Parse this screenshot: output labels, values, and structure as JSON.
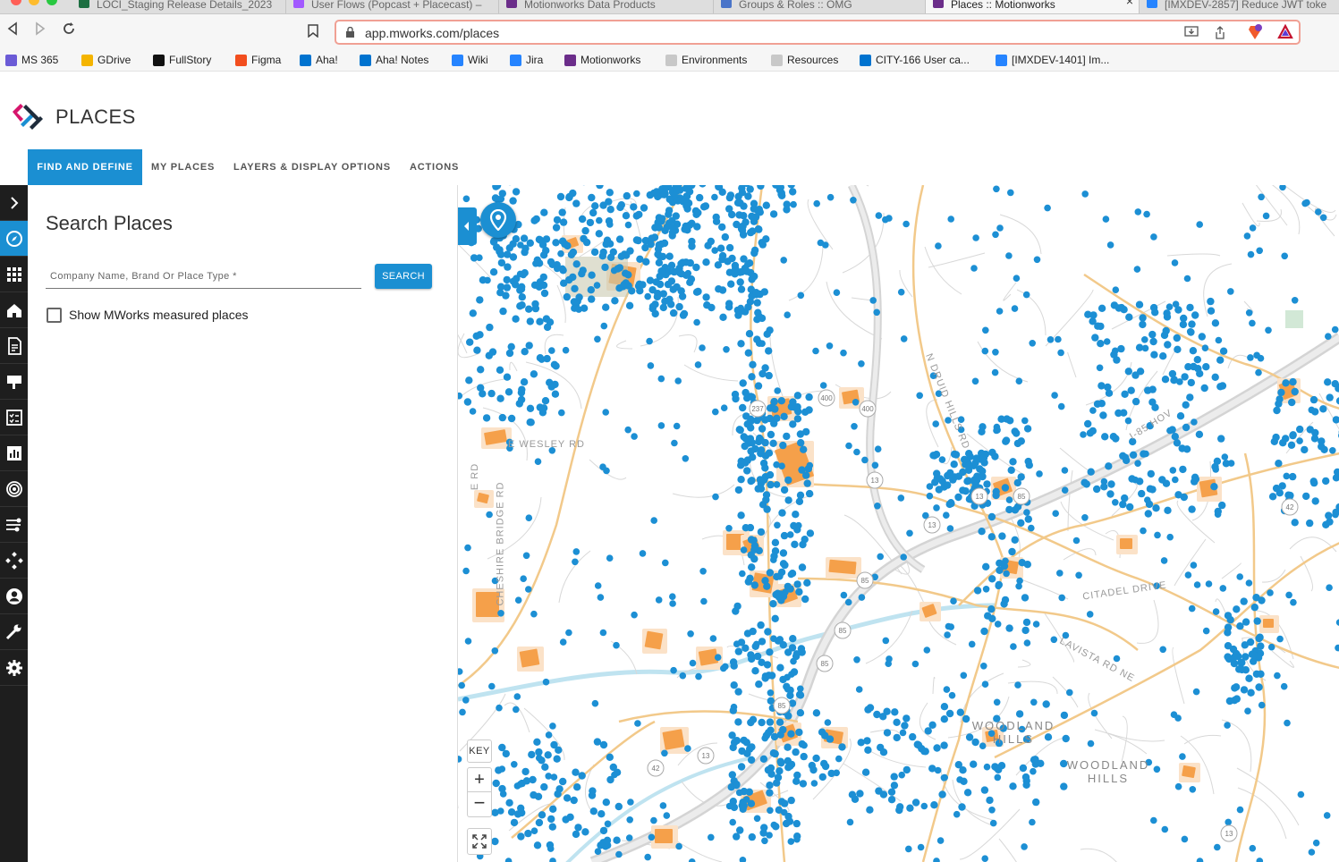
{
  "browser": {
    "tabs": [
      {
        "title": "LOCI_Staging Release Details_2023",
        "favicon_color": "#1d6f42"
      },
      {
        "title": "User Flows (Popcast + Placecast) –",
        "favicon_color": "#a259ff"
      },
      {
        "title": "Motionworks Data Products",
        "favicon_color": "#6b2d8a"
      },
      {
        "title": "Groups & Roles :: OMG",
        "favicon_color": "#4a74c9"
      },
      {
        "title": "Places :: Motionworks",
        "favicon_color": "#6b2d8a",
        "active": true
      },
      {
        "title": "[IMXDEV-2857] Reduce JWT toke",
        "favicon_color": "#2684ff"
      }
    ],
    "url": "app.mworks.com/places",
    "bookmarks": [
      {
        "label": "MS 365",
        "icon_color": "#6b5bd6"
      },
      {
        "label": "GDrive",
        "icon_color": "#f4b400"
      },
      {
        "label": "FullStory",
        "icon_color": "#111111"
      },
      {
        "label": "Figma",
        "icon_color": "#f24e1e"
      },
      {
        "label": "Aha!",
        "icon_color": "#0073cf"
      },
      {
        "label": "Aha! Notes",
        "icon_color": "#0073cf"
      },
      {
        "label": "Wiki",
        "icon_color": "#2684ff"
      },
      {
        "label": "Jira",
        "icon_color": "#2684ff"
      },
      {
        "label": "Motionworks",
        "icon_color": "#6b2d8a"
      },
      {
        "label": "Environments",
        "icon_color": "#c8c8c8"
      },
      {
        "label": "Resources",
        "icon_color": "#c8c8c8"
      },
      {
        "label": "CITY-166 User ca...",
        "icon_color": "#0073cf"
      },
      {
        "label": "[IMXDEV-1401] Im...",
        "icon_color": "#2684ff"
      }
    ]
  },
  "header": {
    "title": "PLACES",
    "tabs": [
      {
        "label": "FIND AND DEFINE",
        "active": true
      },
      {
        "label": "MY PLACES"
      },
      {
        "label": "LAYERS & DISPLAY OPTIONS"
      },
      {
        "label": "ACTIONS"
      }
    ]
  },
  "rail": {
    "items": [
      "expand-icon",
      "compass-icon",
      "grid-icon",
      "home-icon",
      "report-icon",
      "billboard-icon",
      "checklist-icon",
      "chart-icon",
      "target-icon",
      "route-icon",
      "network-icon",
      "user-icon",
      "tools-icon",
      "settings-icon"
    ]
  },
  "search": {
    "title": "Search Places",
    "placeholder": "Company Name, Brand Or Place Type *",
    "button": "SEARCH",
    "checkbox_label": "Show MWorks measured places",
    "checked": false
  },
  "map": {
    "key_label": "KEY",
    "zoom_in": "+",
    "zoom_out": "−",
    "labels": [
      "E WESLEY RD",
      "CITADEL DRIVE",
      "LAVISTA RD NE",
      "WOODLAND HILLS",
      "WOODLAND HILLS",
      "I-85 HOV",
      "N DRUID HILLS RD",
      "CHESHIRE BRIDGE RD",
      "E RD"
    ],
    "shields": [
      "237",
      "400",
      "400",
      "13",
      "13",
      "13",
      "85",
      "85",
      "85",
      "85",
      "85",
      "42",
      "42",
      "13",
      "13"
    ],
    "colors": {
      "poi": "#1c8fd4",
      "place": "#f5a04a",
      "road": "#f2c98a",
      "water": "#bfe3f0"
    }
  }
}
